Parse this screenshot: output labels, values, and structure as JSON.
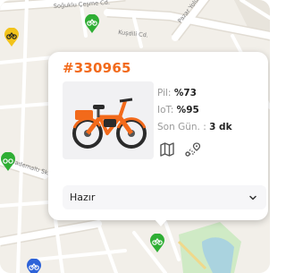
{
  "map": {
    "streets": [
      "Soğuklu Çeşme Cd.",
      "Kuşdili Cd.",
      "Pazar Yolu Sk.",
      "Bademaltı Sk."
    ]
  },
  "vehicle": {
    "id": "#330965",
    "battery_label": "Pil:",
    "battery_value": "%73",
    "iot_label": "IoT:",
    "iot_value": "%95",
    "last_seen_label": "Son Gün. :",
    "last_seen_value": "3 dk",
    "image_icon": "e-bike-photo",
    "actions": [
      "map-icon",
      "route-icon"
    ]
  },
  "status": {
    "selected": "Hazır",
    "icon": "chevron-down-icon"
  },
  "colors": {
    "accent": "#f26a1b",
    "pin_green": "#2fae34",
    "pin_yellow": "#f2c31b",
    "pin_blue": "#2e63d8",
    "map_bg": "#f2efe9",
    "park": "#cfeac5",
    "water": "#aad3df"
  }
}
